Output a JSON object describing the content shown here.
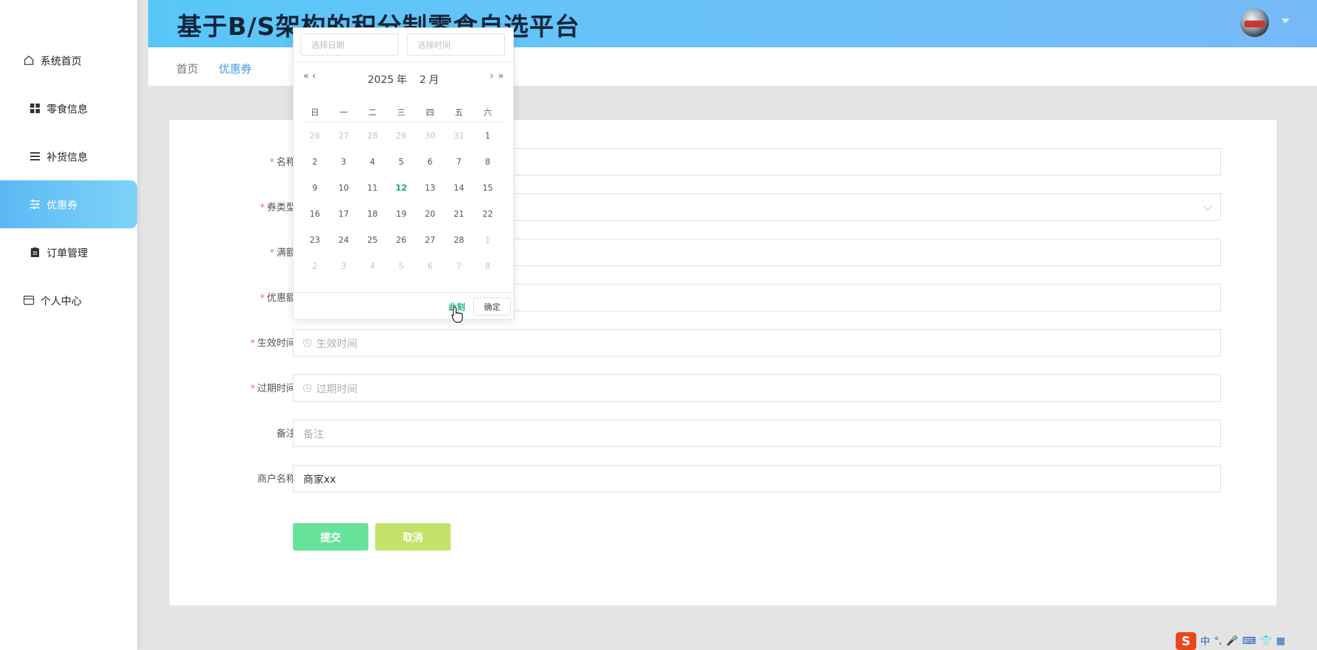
{
  "header": {
    "title": "基于B/S架构的积分制零食自选平台"
  },
  "sidebar": {
    "items": [
      {
        "label": "系统首页",
        "icon": "home-icon"
      },
      {
        "label": "零食信息",
        "icon": "grid-icon"
      },
      {
        "label": "补货信息",
        "icon": "list-icon"
      },
      {
        "label": "优惠券",
        "icon": "sliders-icon"
      },
      {
        "label": "订单管理",
        "icon": "clipboard-icon"
      },
      {
        "label": "个人中心",
        "icon": "card-icon"
      }
    ],
    "active_index": 3
  },
  "breadcrumb": {
    "home": "首页",
    "current": "优惠券"
  },
  "form": {
    "name_label": "名称",
    "type_label": "券类型",
    "full_amount_label": "满额",
    "discount_label": "优惠额",
    "start_label": "生效时间",
    "start_placeholder": "生效时间",
    "end_label": "过期时间",
    "end_placeholder": "过期时间",
    "remark_label": "备注",
    "remark_placeholder": "备注",
    "merchant_label": "商户名称",
    "merchant_value": "商家xx",
    "submit": "提交",
    "cancel": "取消"
  },
  "datepicker": {
    "date_placeholder": "选择日期",
    "time_placeholder": "选择时间",
    "year": "2025",
    "year_suffix": "年",
    "month": "2",
    "month_suffix": "月",
    "weekdays": [
      "日",
      "一",
      "二",
      "三",
      "四",
      "五",
      "六"
    ],
    "weeks": [
      [
        "26",
        "27",
        "28",
        "29",
        "30",
        "31",
        "1"
      ],
      [
        "2",
        "3",
        "4",
        "5",
        "6",
        "7",
        "8"
      ],
      [
        "9",
        "10",
        "11",
        "12",
        "13",
        "14",
        "15"
      ],
      [
        "16",
        "17",
        "18",
        "19",
        "20",
        "21",
        "22"
      ],
      [
        "23",
        "24",
        "25",
        "26",
        "27",
        "28",
        "1"
      ],
      [
        "2",
        "3",
        "4",
        "5",
        "6",
        "7",
        "8"
      ]
    ],
    "today": "12",
    "now_label": "此刻",
    "confirm_label": "确定"
  },
  "tray": {
    "ime_mode": "中",
    "punct": "°,"
  }
}
